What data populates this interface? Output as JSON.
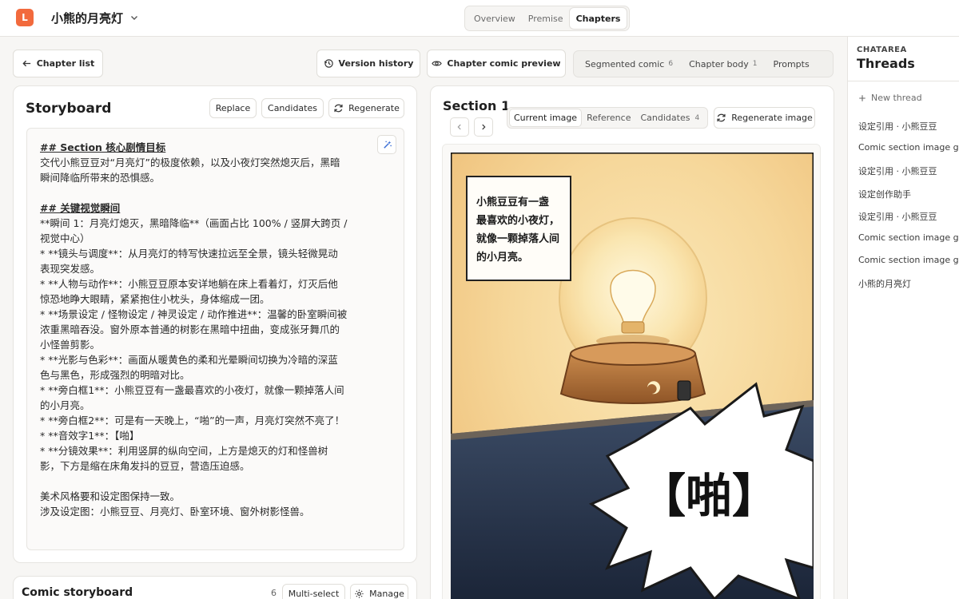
{
  "app": {
    "logo_letter": "L",
    "project_title": "小熊的月亮灯",
    "accent": "#f26a3d"
  },
  "top_tabs": [
    {
      "label": "Overview",
      "active": false
    },
    {
      "label": "Premise",
      "active": false
    },
    {
      "label": "Chapters",
      "active": true
    }
  ],
  "toolbar": {
    "chapter_list": "Chapter list",
    "version_history": "Version history",
    "comic_preview": "Chapter comic preview"
  },
  "secondary_tabs": [
    {
      "label": "Segmented comic",
      "count": "6"
    },
    {
      "label": "Chapter body",
      "count": "1"
    },
    {
      "label": "Prompts",
      "count": ""
    }
  ],
  "storyboard": {
    "title": "Storyboard",
    "replace": "Replace",
    "candidates": "Candidates",
    "regenerate": "Regenerate",
    "lines": [
      "## Section 核心剧情目标",
      "交代小熊豆豆对“月亮灯”的极度依赖，以及小夜灯突然熄灭后，黑暗",
      "瞬间降临所带来的恐惧感。",
      "",
      "## 关键视觉瞬间",
      "**瞬间 1：月亮灯熄灭，黑暗降临**（画面占比 100% / 竖屏大跨页 /",
      "视觉中心）",
      "* **镜头与调度**：从月亮灯的特写快速拉远至全景，镜头轻微晃动",
      "表现突发感。",
      "* **人物与动作**：小熊豆豆原本安详地躺在床上看着灯，灯灭后他",
      "惊恐地睁大眼睛，紧紧抱住小枕头，身体缩成一团。",
      "* **场景设定 / 怪物设定 / 神灵设定 / 动作推进**：温馨的卧室瞬间被",
      "浓重黑暗吞没。窗外原本普通的树影在黑暗中扭曲，变成张牙舞爪的",
      "小怪兽剪影。",
      "* **光影与色彩**：画面从暖黄色的柔和光晕瞬间切换为冷暗的深蓝",
      "色与黑色，形成强烈的明暗对比。",
      "* **旁白框1**：小熊豆豆有一盏最喜欢的小夜灯，就像一颗掉落人间",
      "的小月亮。",
      "* **旁白框2**：可是有一天晚上，“啪”的一声，月亮灯突然不亮了！",
      "* **音效字1**：【啪】",
      "* **分镜效果**：利用竖屏的纵向空间，上方是熄灭的灯和怪兽树",
      "影，下方是缩在床角发抖的豆豆，营造压迫感。",
      "",
      "美术风格要和设定图保持一致。",
      "涉及设定图：小熊豆豆、月亮灯、卧室环境、窗外树影怪兽。"
    ]
  },
  "section": {
    "title": "Section 1",
    "image_tabs": [
      {
        "label": "Current image",
        "count": "",
        "active": true
      },
      {
        "label": "Reference",
        "count": "",
        "active": false
      },
      {
        "label": "Candidates",
        "count": "4",
        "active": false
      }
    ],
    "regenerate_image": "Regenerate image",
    "caption_lines": [
      "小熊豆豆有一盏",
      "最喜欢的小夜灯，",
      "就像一颗掉落人间",
      "的小月亮。"
    ],
    "sfx": "【啪】"
  },
  "comic_storyboard": {
    "title": "Comic storyboard",
    "count": "6",
    "multi_select": "Multi-select",
    "manage": "Manage"
  },
  "sidebar": {
    "kicker": "CHATAREA",
    "title": "Threads",
    "new_thread": "New thread",
    "threads": [
      "设定引用 · 小熊豆豆",
      "Comic section image gen",
      "设定引用 · 小熊豆豆",
      "设定创作助手",
      "设定引用 · 小熊豆豆",
      "Comic section image gen",
      "Comic section image gen",
      "小熊的月亮灯"
    ]
  }
}
